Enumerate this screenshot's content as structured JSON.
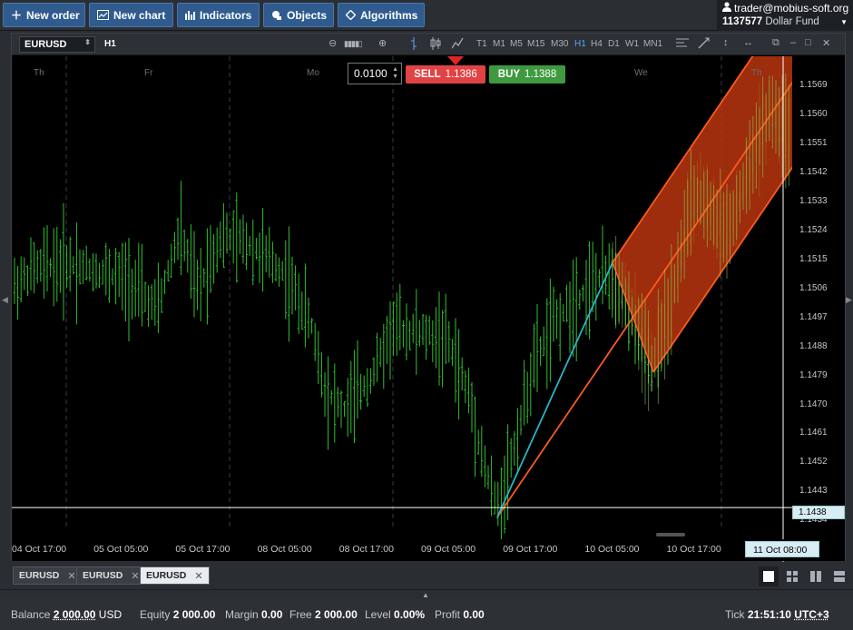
{
  "toolbar": {
    "buttons": [
      {
        "label": "New order",
        "icon": "plus-icon"
      },
      {
        "label": "New chart",
        "icon": "chart-window-icon"
      },
      {
        "label": "Indicators",
        "icon": "bar-indicator-icon"
      },
      {
        "label": "Objects",
        "icon": "objects-icon"
      },
      {
        "label": "Algorithms",
        "icon": "diamond-icon"
      }
    ]
  },
  "account": {
    "user": "trader@mobius-soft.org",
    "number": "1137577",
    "fund": "Dollar Fund"
  },
  "chart": {
    "symbol": "EURUSD",
    "timeframe": "H1",
    "timeframes": [
      "T1",
      "M1",
      "M5",
      "M15",
      "M30",
      "H1",
      "H4",
      "D1",
      "W1",
      "MN1"
    ],
    "active_timeframe": "H1",
    "lot": "0.0100",
    "sell_label": "SELL",
    "sell_price": "1.1386",
    "buy_label": "BUY",
    "buy_price": "1.1388",
    "day_labels": [
      "Th",
      "Fr",
      "Mo",
      "We",
      "Th"
    ],
    "current_price": "1.1438",
    "current_time": "11 Oct 08:00",
    "colors": {
      "candle": "#2fbf2f",
      "channel": "#ff5a1f",
      "trend": "#2ab3c8",
      "sell": "#e04343",
      "buy": "#3f9a3f"
    }
  },
  "chart_data": {
    "type": "candlestick",
    "symbol": "EURUSD",
    "timeframe": "H1",
    "x_ticks": [
      "04 Oct 17:00",
      "05 Oct 05:00",
      "05 Oct 17:00",
      "08 Oct 05:00",
      "08 Oct 17:00",
      "09 Oct 05:00",
      "09 Oct 17:00",
      "10 Oct 05:00",
      "10 Oct 17:00"
    ],
    "y_ticks": [
      "1.1569",
      "1.1560",
      "1.1551",
      "1.1542",
      "1.1533",
      "1.1524",
      "1.1515",
      "1.1506",
      "1.1497",
      "1.1488",
      "1.1479",
      "1.1470",
      "1.1461",
      "1.1452",
      "1.1443",
      "1.1434"
    ],
    "ylim": [
      1.1431,
      1.1578
    ],
    "current_price": 1.1438,
    "grid": true
  },
  "tabs": [
    {
      "label": "EURUSD",
      "active": false
    },
    {
      "label": "EURUSD",
      "active": false
    },
    {
      "label": "EURUSD",
      "active": true
    }
  ],
  "status": {
    "balance_label": "Balance",
    "balance": "2 000.00",
    "currency": "USD",
    "equity_label": "Equity",
    "equity": "2 000.00",
    "margin_label": "Margin",
    "margin": "0.00",
    "free_label": "Free",
    "free": "2 000.00",
    "level_label": "Level",
    "level": "0.00%",
    "profit_label": "Profit",
    "profit": "0.00",
    "tick_label": "Tick",
    "time": "21:51:10",
    "timezone": "UTC+3"
  }
}
